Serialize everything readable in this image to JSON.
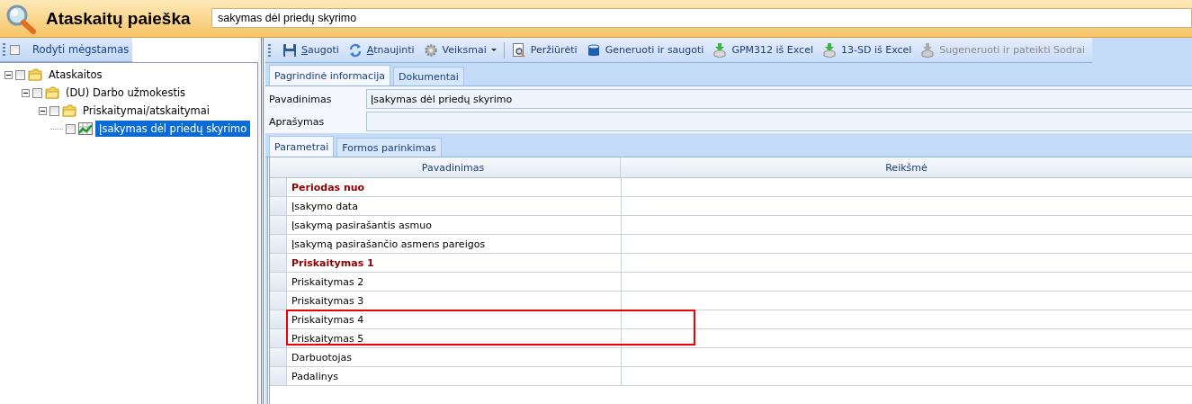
{
  "header": {
    "title": "Ataskaitų paieška",
    "search": {
      "value": "sakymas dėl priedų skyrimo"
    }
  },
  "left_toolbar": {
    "favorites": {
      "label": "Rodyti mėgstamas",
      "checked": false
    }
  },
  "tree": [
    {
      "label": "Ataskaitos",
      "expanded": true,
      "checked": false,
      "selected": false,
      "children": [
        {
          "label": "(DU) Darbo užmokestis",
          "expanded": true,
          "checked": false,
          "selected": false,
          "children": [
            {
              "label": "Priskaitymai/atskaitymai",
              "expanded": true,
              "checked": false,
              "selected": false,
              "children": [
                {
                  "label": "Įsakymas dėl priedų skyrimo",
                  "checked": false,
                  "selected": true
                }
              ]
            }
          ]
        }
      ]
    }
  ],
  "toolbar": [
    {
      "kind": "button",
      "label": "Saugoti",
      "mnemonic": true,
      "disabled": false,
      "dropdown": false
    },
    {
      "kind": "button",
      "label": "Atnaujinti",
      "mnemonic": true,
      "disabled": false,
      "dropdown": false
    },
    {
      "kind": "button",
      "label": "Veiksmai",
      "mnemonic": false,
      "disabled": false,
      "dropdown": true
    },
    {
      "kind": "separator"
    },
    {
      "kind": "button",
      "label": "Peržiūrėti",
      "mnemonic": false,
      "disabled": false,
      "dropdown": false
    },
    {
      "kind": "button",
      "label": "Generuoti ir saugoti",
      "mnemonic": false,
      "disabled": false,
      "dropdown": false
    },
    {
      "kind": "button",
      "label": "GPM312 iš Excel",
      "mnemonic": false,
      "disabled": false,
      "dropdown": false
    },
    {
      "kind": "button",
      "label": "13-SD iš Excel",
      "mnemonic": false,
      "disabled": false,
      "dropdown": false
    },
    {
      "kind": "button",
      "label": "Sugeneruoti ir pateikti Sodrai",
      "mnemonic": false,
      "disabled": true,
      "dropdown": false
    }
  ],
  "tabs": [
    {
      "label": "Pagrindinė informacija",
      "selected": true
    },
    {
      "label": "Dokumentai",
      "selected": false
    }
  ],
  "fields": [
    {
      "label": "Pavadinimas",
      "value": "Įsakymas dėl priedų skyrimo"
    },
    {
      "label": "Aprašymas"
    }
  ],
  "sub_tabs": [
    {
      "label": "Parametrai",
      "selected": true
    },
    {
      "label": "Formos parinkimas",
      "selected": false
    }
  ],
  "table": {
    "columns": [
      "Pavadinimas",
      "Reikšmė"
    ],
    "rows": [
      {
        "name": "Periodas nuo",
        "emphasized": true,
        "highlighted": false
      },
      {
        "name": "Įsakymo data",
        "emphasized": false,
        "highlighted": false
      },
      {
        "name": "Įsakymą pasirašantis asmuo",
        "emphasized": false,
        "highlighted": false
      },
      {
        "name": "Įsakymą pasirašančio asmens pareigos",
        "emphasized": false,
        "highlighted": false
      },
      {
        "name": "Priskaitymas 1",
        "emphasized": true,
        "highlighted": false
      },
      {
        "name": "Priskaitymas 2",
        "emphasized": false,
        "highlighted": false
      },
      {
        "name": "Priskaitymas 3",
        "emphasized": false,
        "highlighted": false
      },
      {
        "name": "Priskaitymas 4",
        "emphasized": false,
        "highlighted": true
      },
      {
        "name": "Priskaitymas 5",
        "emphasized": false,
        "highlighted": true
      },
      {
        "name": "Darbuotojas",
        "emphasized": false,
        "highlighted": false
      },
      {
        "name": "Padalinys",
        "emphasized": false,
        "highlighted": false
      }
    ]
  }
}
